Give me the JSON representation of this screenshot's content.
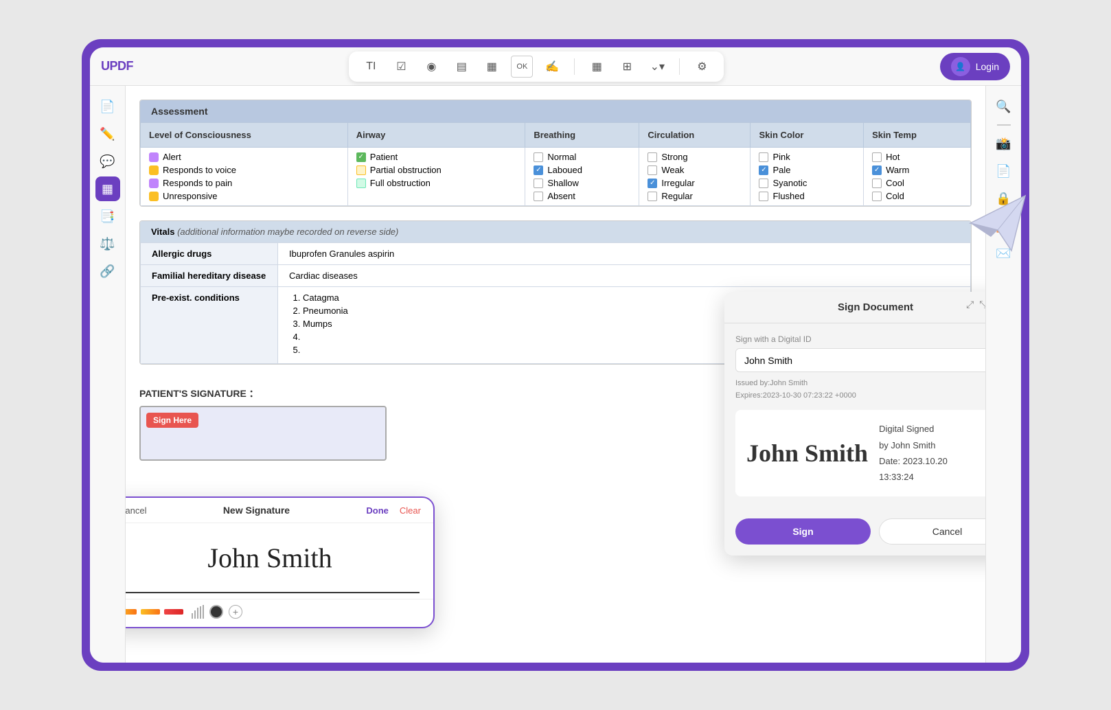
{
  "app": {
    "logo": "UPDF",
    "login_label": "Login"
  },
  "toolbar": {
    "icons": [
      "TI",
      "☑",
      "◉",
      "▤",
      "▦",
      "OK",
      "✍",
      "|",
      "▦",
      "⊞",
      "⌄",
      "⚙"
    ]
  },
  "sidebar_left": {
    "icons": [
      "📄",
      "✏️",
      "📋",
      "🖼️",
      "✨",
      "📑",
      "🔗"
    ]
  },
  "sidebar_right": {
    "icons": [
      "🔍",
      "—",
      "📷",
      "📄",
      "🔒",
      "📤",
      "✉️"
    ]
  },
  "assessment": {
    "section_title": "Assessment",
    "columns": [
      "Level of Consciousness",
      "Airway",
      "Breathing",
      "Circulation",
      "Skin Color",
      "Skin Temp"
    ],
    "level_of_consciousness": [
      {
        "label": "Alert",
        "checked": false,
        "color": "#c084fc"
      },
      {
        "label": "Responds to voice",
        "checked": true,
        "color": "#fbbf24"
      },
      {
        "label": "Responds to pain",
        "checked": false,
        "color": "#c084fc"
      },
      {
        "label": "Unresponsive",
        "checked": false,
        "color": "#fbbf24"
      }
    ],
    "airway": [
      {
        "label": "Patient",
        "checked": true,
        "style": "green"
      },
      {
        "label": "Partial obstruction",
        "checked": false,
        "style": "yellow"
      },
      {
        "label": "Full obstruction",
        "checked": false,
        "style": "green"
      }
    ],
    "breathing": [
      {
        "label": "Normal",
        "checked": false
      },
      {
        "label": "Laboued",
        "checked": true
      },
      {
        "label": "Shallow",
        "checked": false
      },
      {
        "label": "Absent",
        "checked": false
      }
    ],
    "circulation": [
      {
        "label": "Strong",
        "checked": false
      },
      {
        "label": "Weak",
        "checked": false
      },
      {
        "label": "Irregular",
        "checked": true
      },
      {
        "label": "Regular",
        "checked": false
      }
    ],
    "skin_color": [
      {
        "label": "Pink",
        "checked": false
      },
      {
        "label": "Pale",
        "checked": true
      },
      {
        "label": "Syanotic",
        "checked": false
      },
      {
        "label": "Flushed",
        "checked": false
      }
    ],
    "skin_temp": [
      {
        "label": "Hot",
        "checked": false
      },
      {
        "label": "Warm",
        "checked": true
      },
      {
        "label": "Cool",
        "checked": false
      },
      {
        "label": "Cold",
        "checked": false
      }
    ]
  },
  "vitals": {
    "section_title": "Vitals",
    "section_note": "(additional information maybe recorded on reverse side)",
    "rows": [
      {
        "label": "Allergic drugs",
        "value": "Ibuprofen Granules  aspirin"
      },
      {
        "label": "Familial hereditary disease",
        "value": "Cardiac diseases"
      },
      {
        "label": "Pre-exist. conditions",
        "items": [
          "Catagma",
          "Pneumonia",
          "Mumps",
          "",
          ""
        ]
      }
    ]
  },
  "patient_signature": {
    "label": "PATIENT'S SIGNATURE ：",
    "sign_here": "Sign Here"
  },
  "new_signature": {
    "cancel_label": "Cancel",
    "title": "New Signature",
    "done_label": "Done",
    "clear_label": "Clear",
    "signature_text": "John Smith",
    "plus_label": "+"
  },
  "sign_document": {
    "title": "Sign Document",
    "sign_with_label": "Sign with a Digital ID",
    "signer_name": "John Smith",
    "issued_by": "Issued by:John Smith",
    "expires": "Expires:2023-10-30 07:23:22 +0000",
    "ds_name": "John Smith",
    "ds_title": "Digital Signed",
    "ds_by": "by John Smith",
    "ds_date": "Date: 2023.10.20",
    "ds_time": "13:33:24",
    "sign_btn": "Sign",
    "cancel_btn": "Cancel"
  }
}
